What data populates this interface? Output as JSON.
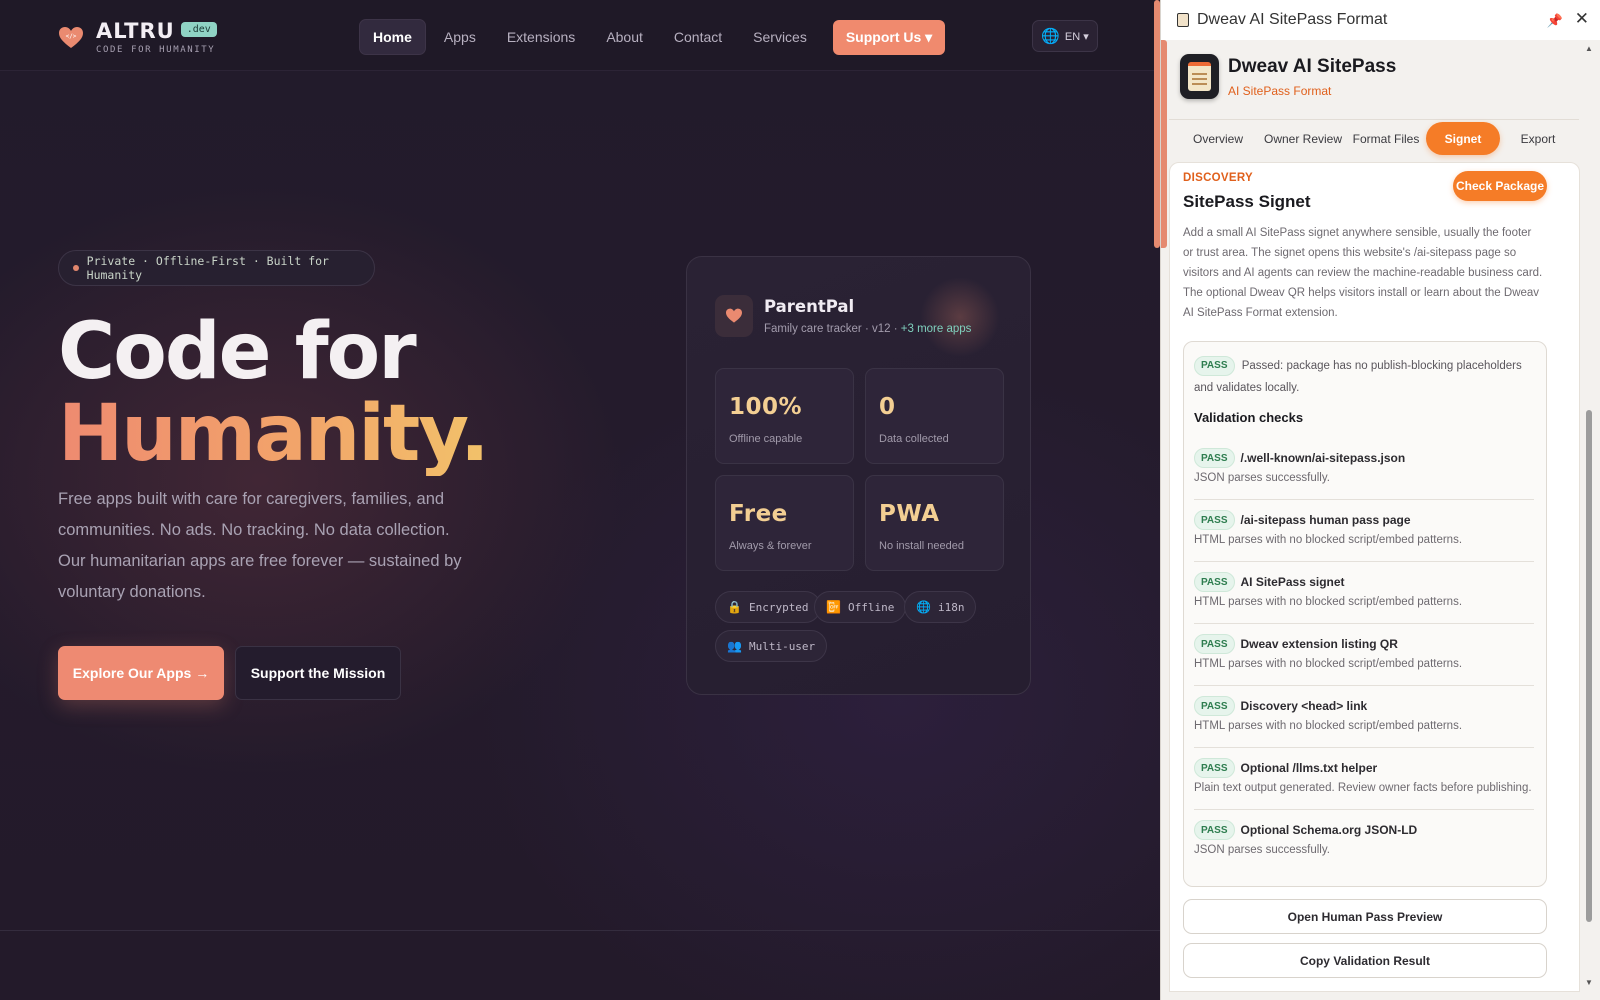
{
  "site": {
    "logo": {
      "name": "ALTRU",
      "badge": ".dev",
      "tagline": "CODE FOR HUMANITY"
    },
    "nav": {
      "items": [
        "Home",
        "Apps",
        "Extensions",
        "About",
        "Contact",
        "Services"
      ],
      "support": "Support Us ▾",
      "lang": "EN ▾"
    },
    "pill": "Private · Offline-First · Built for Humanity",
    "hero_line1": "Code for",
    "hero_line2": "Humanity.",
    "description": "Free apps built with care for caregivers, families, and communities. No ads. No tracking. No data collection. Our humanitarian apps are free forever — sustained by voluntary donations.",
    "btn_explore": "Explore Our Apps →",
    "btn_support": "Support the Mission",
    "card": {
      "title": "ParentPal",
      "subtitle": "Family care tracker · v12 ·",
      "more": "+3 more apps",
      "stats": [
        {
          "value": "100%",
          "label": "Offline capable"
        },
        {
          "value": "0",
          "label": "Data collected"
        },
        {
          "value": "Free",
          "label": "Always & forever"
        },
        {
          "value": "PWA",
          "label": "No install needed"
        }
      ],
      "chips": [
        {
          "icon": "🔒",
          "label": "Encrypted"
        },
        {
          "icon": "📴",
          "label": "Offline"
        },
        {
          "icon": "🌐",
          "label": "i18n"
        },
        {
          "icon": "👥",
          "label": "Multi-user"
        }
      ]
    }
  },
  "panel": {
    "window_title": "Dweav AI SitePass Format",
    "app_name": "Dweav AI SitePass",
    "app_subtitle": "AI SitePass Format",
    "tabs": [
      "Overview",
      "Owner Review",
      "Format Files",
      "Signet",
      "Export"
    ],
    "active_tab": "Signet",
    "section_label": "DISCOVERY",
    "section_title": "SitePass Signet",
    "check_button": "Check Package",
    "description": "Add a small AI SitePass signet anywhere sensible, usually the footer or trust area. The signet opens this website's /ai-sitepass page so visitors and AI agents can review the machine-readable business card. The optional Dweav QR helps visitors install or learn about the Dweav AI SitePass Format extension.",
    "pass_label": "PASS",
    "summary": "Passed: package has no publish-blocking placeholders and validates locally.",
    "checks_title": "Validation checks",
    "checks": [
      {
        "name": "/.well-known/ai-sitepass.json",
        "msg": "JSON parses successfully."
      },
      {
        "name": "/ai-sitepass human pass page",
        "msg": "HTML parses with no blocked script/embed patterns."
      },
      {
        "name": "AI SitePass signet",
        "msg": "HTML parses with no blocked script/embed patterns."
      },
      {
        "name": "Dweav extension listing QR",
        "msg": "HTML parses with no blocked script/embed patterns."
      },
      {
        "name": "Discovery <head> link",
        "msg": "HTML parses with no blocked script/embed patterns."
      },
      {
        "name": "Optional /llms.txt helper",
        "msg": "Plain text output generated. Review owner facts before publishing."
      },
      {
        "name": "Optional Schema.org JSON-LD",
        "msg": "JSON parses successfully."
      }
    ],
    "btn_preview": "Open Human Pass Preview",
    "btn_copy": "Copy Validation Result"
  },
  "colors": {
    "accent_site": "#ee8a72",
    "accent_panel": "#f57c27",
    "pass_green": "#2e7d4f"
  }
}
